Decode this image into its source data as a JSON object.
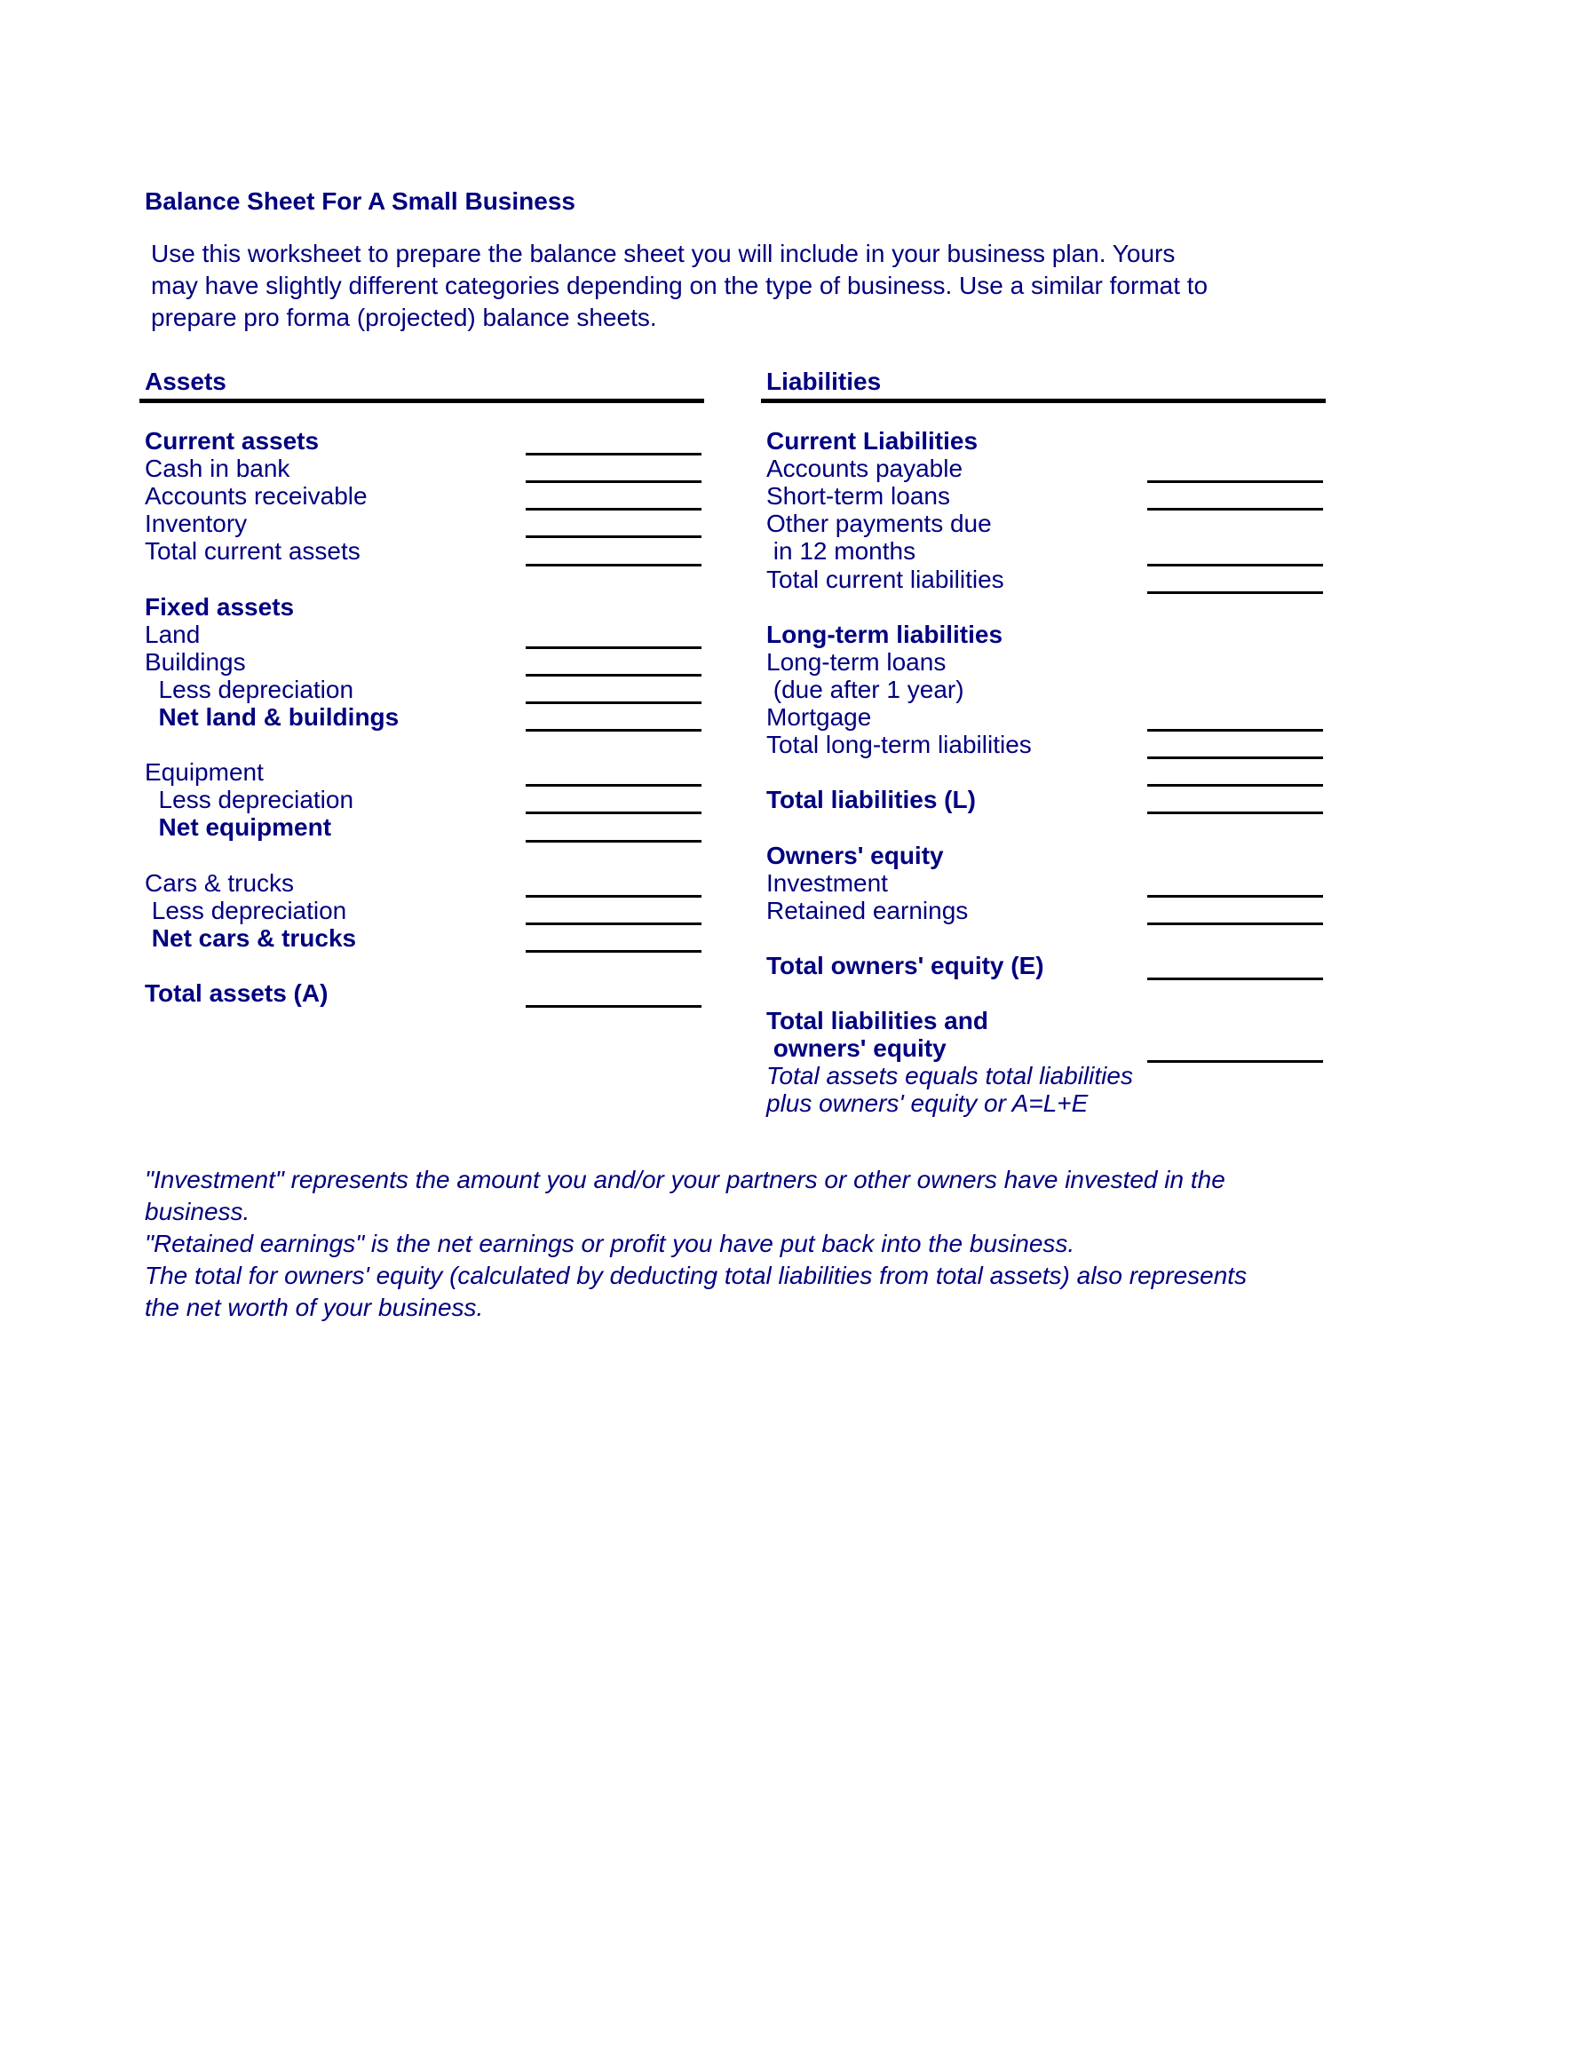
{
  "title": "Balance Sheet For A Small Business",
  "intro_lines": [
    "Use this worksheet to prepare the balance sheet you will include in your business plan.  Yours",
    "may have slightly different categories depending on the type of business.  Use a similar format to",
    "prepare pro forma (projected) balance sheets."
  ],
  "assets": {
    "header": "Assets",
    "rows": [
      {
        "label": "Current assets",
        "style": "bold"
      },
      {
        "label": "Cash in bank"
      },
      {
        "label": "Accounts receivable"
      },
      {
        "label": "Inventory"
      },
      {
        "label": "Total current assets"
      },
      {
        "label": ""
      },
      {
        "label": "Fixed assets",
        "style": "bold"
      },
      {
        "label": "Land"
      },
      {
        "label": "Buildings"
      },
      {
        "label": "  Less depreciation"
      },
      {
        "label": "  Net land & buildings",
        "style": "bold"
      },
      {
        "label": ""
      },
      {
        "label": "Equipment"
      },
      {
        "label": "  Less depreciation"
      },
      {
        "label": "  Net equipment",
        "style": "bold"
      },
      {
        "label": ""
      },
      {
        "label": "Cars & trucks"
      },
      {
        "label": " Less depreciation"
      },
      {
        "label": " Net cars & trucks",
        "style": "bold"
      },
      {
        "label": ""
      },
      {
        "label": "Total assets (A)",
        "style": "bold"
      }
    ]
  },
  "liabilities": {
    "header": "Liabilities",
    "rows": [
      {
        "label": "Current Liabilities",
        "style": "bold"
      },
      {
        "label": "Accounts payable"
      },
      {
        "label": "Short-term loans"
      },
      {
        "label": "Other payments due"
      },
      {
        "label": " in 12 months"
      },
      {
        "label": "Total current liabilities"
      },
      {
        "label": ""
      },
      {
        "label": "Long-term liabilities",
        "style": "bold"
      },
      {
        "label": "Long-term loans"
      },
      {
        "label": " (due after 1 year)"
      },
      {
        "label": "Mortgage"
      },
      {
        "label": "Total long-term liabilities"
      },
      {
        "label": ""
      },
      {
        "label": "Total liabilities (L)",
        "style": "bold"
      },
      {
        "label": ""
      },
      {
        "label": "Owners' equity",
        "style": "bold"
      },
      {
        "label": "Investment"
      },
      {
        "label": "Retained earnings"
      },
      {
        "label": ""
      },
      {
        "label": "Total owners' equity (E)",
        "style": "bold"
      },
      {
        "label": ""
      },
      {
        "label": "Total liabilities and",
        "style": "bold"
      },
      {
        "label": " owners' equity",
        "style": "bold"
      },
      {
        "label": "Total assets equals total liabilities",
        "style": "italic"
      },
      {
        "label": "plus owners' equity or A=L+E",
        "style": "italic"
      }
    ]
  },
  "notes": [
    "\"Investment\" represents the amount you and/or your partners or other owners have invested in the",
    "business.",
    "\"Retained earnings\" is the net earnings or profit you have put back into the business.",
    "The total for owners' equity (calculated by deducting total liabilities from total assets) also represents",
    "the net worth of your business."
  ]
}
